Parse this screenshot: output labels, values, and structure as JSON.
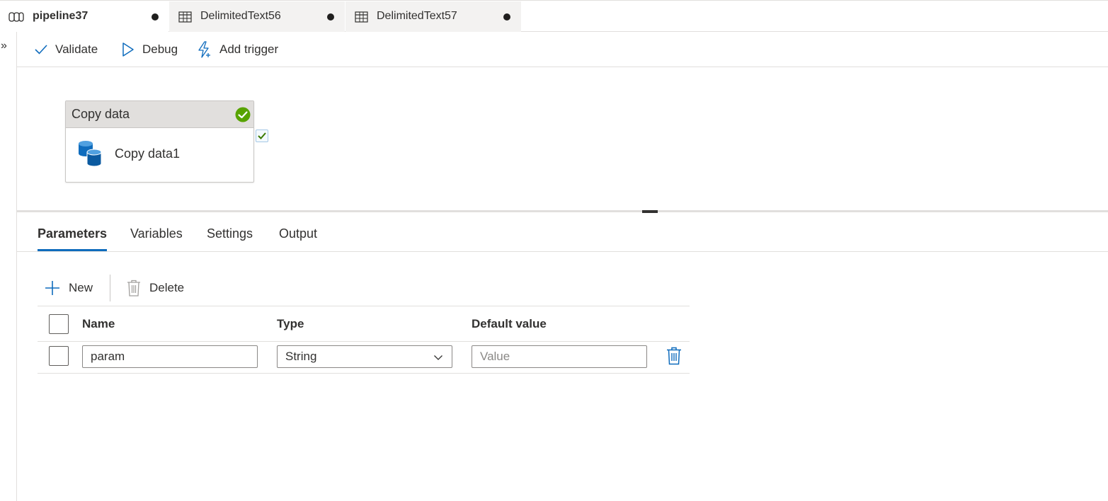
{
  "tabs": [
    {
      "label": "pipeline37",
      "icon": "pipeline-icon",
      "active": true,
      "dirty": true
    },
    {
      "label": "DelimitedText56",
      "icon": "table-icon",
      "active": false,
      "dirty": true
    },
    {
      "label": "DelimitedText57",
      "icon": "table-icon",
      "active": false,
      "dirty": true
    }
  ],
  "sidebar": {
    "expand_glyph": "»",
    "icon": "expand-chevrons-icon"
  },
  "toolbar": {
    "validate_label": "Validate",
    "debug_label": "Debug",
    "add_trigger_label": "Add trigger"
  },
  "canvas": {
    "activity": {
      "type_label": "Copy data",
      "name": "Copy data1",
      "status": "succeeded",
      "status_icon": "success-check-icon",
      "activity_icon": "database-copy-icon"
    }
  },
  "panel": {
    "tabs": [
      {
        "label": "Parameters",
        "active": true
      },
      {
        "label": "Variables",
        "active": false
      },
      {
        "label": "Settings",
        "active": false
      },
      {
        "label": "Output",
        "active": false
      }
    ],
    "new_label": "New",
    "delete_label": "Delete",
    "columns": {
      "name": "Name",
      "type": "Type",
      "default_value": "Default value"
    },
    "rows": [
      {
        "name": "param",
        "type": "String",
        "default_value_placeholder": "Value"
      }
    ]
  },
  "colors": {
    "accent": "#0f6cbd",
    "success": "#57a300",
    "tab_inactive_bg": "#f3f2f1",
    "header_bg": "#e1dfdd"
  }
}
